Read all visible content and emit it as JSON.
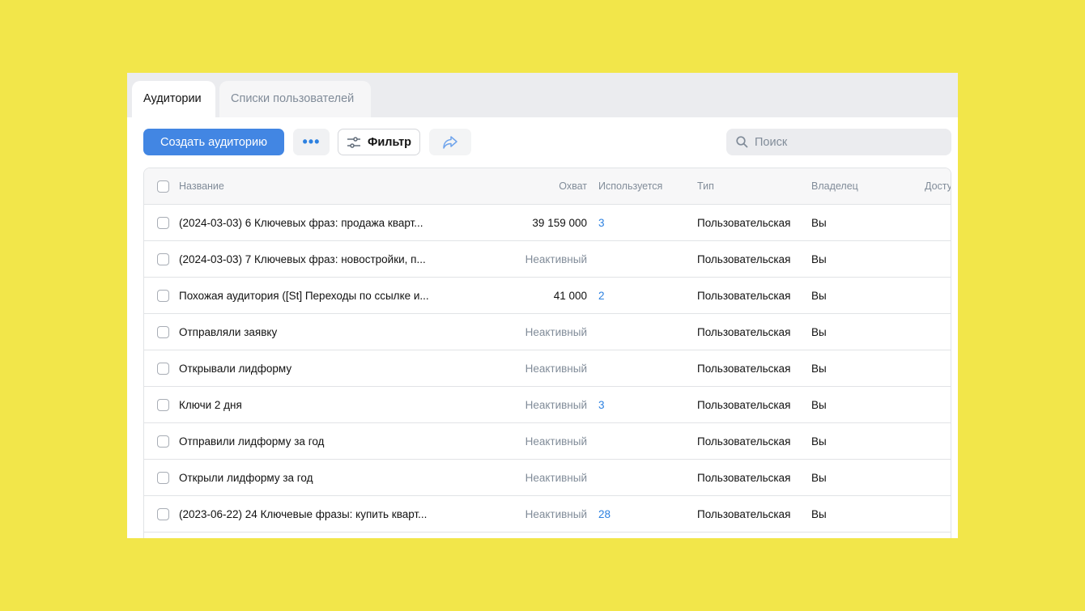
{
  "tabs": [
    {
      "label": "Аудитории",
      "active": true
    },
    {
      "label": "Списки пользователей",
      "active": false
    }
  ],
  "toolbar": {
    "create_label": "Создать аудиторию",
    "more_label": "•••",
    "filter_label": "Фильтр",
    "search_placeholder": "Поиск"
  },
  "colors": {
    "accent": "#4286e3",
    "link": "#2d81e0",
    "background": "#f2e64a"
  },
  "table": {
    "headers": {
      "name": "Название",
      "reach": "Охват",
      "used": "Используется",
      "type": "Тип",
      "owner": "Владелец",
      "access": "Досту"
    },
    "rows": [
      {
        "name": "(2024-03-03) 6 Ключевых фраз: продажа кварт...",
        "reach": "39 159 000",
        "reach_inactive": false,
        "used": "3",
        "type": "Пользовательская",
        "owner": "Вы"
      },
      {
        "name": "(2024-03-03) 7 Ключевых фраз: новостройки, п...",
        "reach": "Неактивный",
        "reach_inactive": true,
        "used": "",
        "type": "Пользовательская",
        "owner": "Вы"
      },
      {
        "name": "Похожая аудитория ([St] Переходы по ссылке и...",
        "reach": "41 000",
        "reach_inactive": false,
        "used": "2",
        "type": "Пользовательская",
        "owner": "Вы"
      },
      {
        "name": "Отправляли заявку",
        "reach": "Неактивный",
        "reach_inactive": true,
        "used": "",
        "type": "Пользовательская",
        "owner": "Вы"
      },
      {
        "name": "Открывали лидформу",
        "reach": "Неактивный",
        "reach_inactive": true,
        "used": "",
        "type": "Пользовательская",
        "owner": "Вы"
      },
      {
        "name": "Ключи 2 дня",
        "reach": "Неактивный",
        "reach_inactive": true,
        "used": "3",
        "type": "Пользовательская",
        "owner": "Вы"
      },
      {
        "name": "Отправили лидформу за год",
        "reach": "Неактивный",
        "reach_inactive": true,
        "used": "",
        "type": "Пользовательская",
        "owner": "Вы"
      },
      {
        "name": "Открыли лидформу за год",
        "reach": "Неактивный",
        "reach_inactive": true,
        "used": "",
        "type": "Пользовательская",
        "owner": "Вы"
      },
      {
        "name": "(2023-06-22) 24 Ключевые фразы: купить кварт...",
        "reach": "Неактивный",
        "reach_inactive": true,
        "used": "28",
        "type": "Пользовательская",
        "owner": "Вы"
      }
    ]
  }
}
